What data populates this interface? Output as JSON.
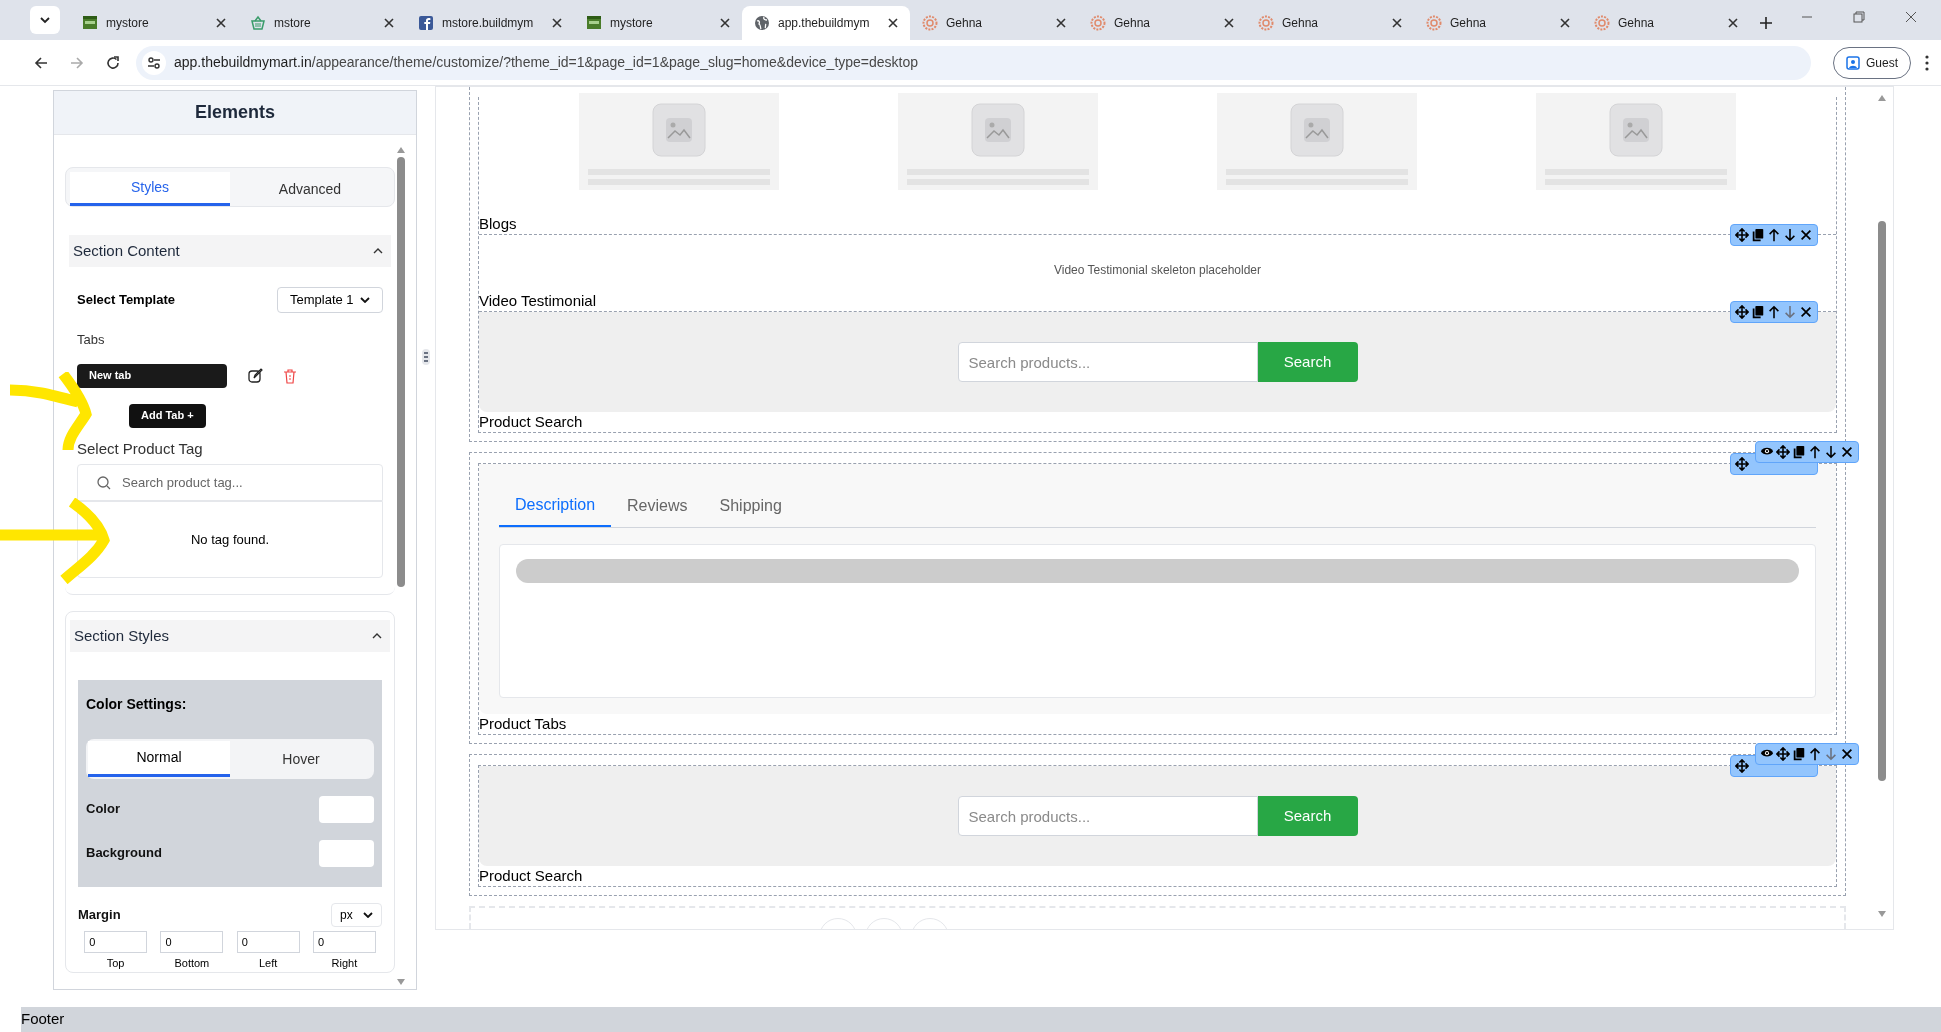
{
  "browser": {
    "tabs": [
      {
        "title": "mystore",
        "kind": "store",
        "selected": false
      },
      {
        "title": "mstore",
        "kind": "basket",
        "selected": false
      },
      {
        "title": "mstore.buildmym",
        "kind": "facebook",
        "selected": false
      },
      {
        "title": "mystore",
        "kind": "store",
        "selected": false
      },
      {
        "title": "app.thebuildmym",
        "kind": "globe",
        "selected": true
      },
      {
        "title": "Gehna",
        "kind": "sun",
        "selected": false
      },
      {
        "title": "Gehna",
        "kind": "sun",
        "selected": false
      },
      {
        "title": "Gehna",
        "kind": "sun",
        "selected": false
      },
      {
        "title": "Gehna",
        "kind": "sun",
        "selected": false
      },
      {
        "title": "Gehna",
        "kind": "sun",
        "selected": false
      }
    ],
    "url_host": "app.thebuildmymart.in",
    "url_path": "/appearance/theme/customize/?theme_id=1&page_id=1&page_slug=home&device_type=desktop",
    "profile": "Guest"
  },
  "sidebar": {
    "title": "Elements",
    "tabs": [
      {
        "label": "Styles",
        "selected": true
      },
      {
        "label": "Advanced",
        "selected": false
      }
    ],
    "section_content": {
      "title": "Section Content",
      "template_label": "Select Template",
      "template_value": "Template 1",
      "tabs_label": "Tabs",
      "tab_items": [
        "New tab"
      ],
      "add_tab": "Add Tab +",
      "tag_label": "Select Product Tag",
      "tag_placeholder": "Search product tag...",
      "tag_empty": "No tag found."
    },
    "section_styles": {
      "title": "Section Styles",
      "color_title": "Color Settings:",
      "modes": [
        {
          "label": "Normal",
          "selected": true
        },
        {
          "label": "Hover",
          "selected": false
        }
      ],
      "colors": [
        {
          "label": "Color",
          "color": "#ffffff"
        },
        {
          "label": "Background",
          "color": "#ffffff"
        }
      ],
      "margin_label": "Margin",
      "unit": "px",
      "margins": [
        {
          "value": "0",
          "label": "Top"
        },
        {
          "value": "0",
          "label": "Bottom"
        },
        {
          "value": "0",
          "label": "Left"
        },
        {
          "value": "0",
          "label": "Right"
        }
      ]
    }
  },
  "canvas": {
    "groups": [
      {
        "sections": [
          {
            "kind": "blogs",
            "label": "Blogs"
          },
          {
            "kind": "video",
            "label": "Video Testimonial",
            "placeholder": "Video Testimonial skeleton placeholder",
            "toolbar": {
              "covered": false,
              "down_disabled": false
            }
          },
          {
            "kind": "search",
            "label": "Product Search",
            "placeholder": "Search products...",
            "button": "Search",
            "toolbar": {
              "covered": false,
              "down_disabled": true
            }
          }
        ]
      },
      {
        "toolbar": {
          "down_disabled": false
        },
        "sections": [
          {
            "kind": "tabs",
            "label": "Product Tabs",
            "tabs": [
              {
                "label": "Description",
                "selected": true
              },
              {
                "label": "Reviews",
                "selected": false
              },
              {
                "label": "Shipping",
                "selected": false
              }
            ],
            "toolbar": {
              "covered": true
            }
          }
        ]
      },
      {
        "toolbar": {
          "down_disabled": true
        },
        "sections": [
          {
            "kind": "search",
            "label": "Product Search",
            "placeholder": "Search products...",
            "button": "Search",
            "toolbar": {
              "covered": true
            }
          }
        ]
      }
    ]
  },
  "footer": "Footer"
}
